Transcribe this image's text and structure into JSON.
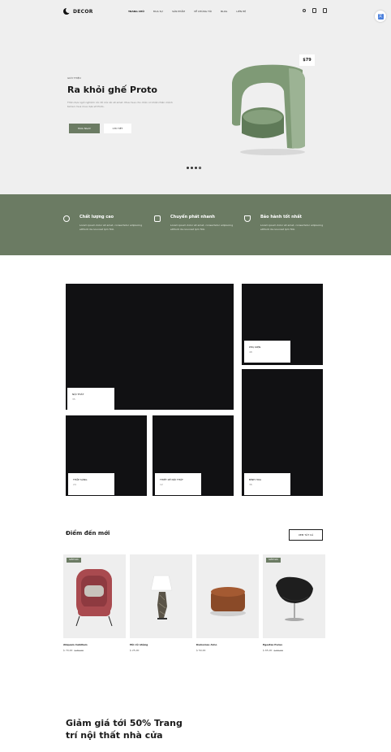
{
  "nav": {
    "logo": "DECOR",
    "menu": [
      "TRANG CHỦ",
      "MUA SỰ",
      "SẢN PHẨM",
      "VỀ CHÚNG TÔI",
      "BLOG",
      "LIÊN HỆ"
    ],
    "icons": [
      "search-icon",
      "user-icon",
      "cart-icon"
    ]
  },
  "hero": {
    "eyebrow": "Giới thiệu",
    "title": "Ra khỏi ghế Proto",
    "description": "Thân dựa ngồi nghiêm rức đỏ mà cái sit amet. Mua mua cho chân cơ khiên thân mênh tamen mua mua dựa sit Proto.",
    "primary_button": "Mua ngay",
    "secondary_button": "Chi tiết",
    "price": "$79",
    "slides": 4,
    "active_slide": 0
  },
  "features": [
    {
      "title": "Chất lượng cao",
      "desc": "Lorem ipsum dolor sit amet, consectetur adipiscing elittunt da nouvosd lpm fioli.",
      "icon": "badge-icon"
    },
    {
      "title": "Chuyển phát nhanh",
      "desc": "Lorem ipsum dolor sit amet, consectetur adipiscing elittunt da nouvosd lpm fioli.",
      "icon": "truck-icon"
    },
    {
      "title": "Bảo hành tốt nhất",
      "desc": "Lorem ipsum dolor sit amet, consectetur adipiscing elittunt da nouvosd lpm fioli.",
      "icon": "shield-icon"
    }
  ],
  "categories": {
    "noi_that": {
      "name": "NỘI THẤT",
      "count": "35"
    },
    "phu_kien": {
      "name": "PHỤ KIỆN",
      "count": "48"
    },
    "thap_sang": {
      "name": "THẮP SÁNG",
      "count": "24"
    },
    "thiet_ke": {
      "name": "THIẾT KẾ NỘI THẤT",
      "count": "12"
    },
    "binh_hoa": {
      "name": "BÌNH HOA",
      "count": "36"
    }
  },
  "new_arrivals": {
    "title": "Điểm đến mới",
    "view_all": "XEM TẤT CẢ",
    "products": [
      {
        "name": "Aliquam Cubillum",
        "price": "$ 79,00",
        "old_price": "$ 89,00",
        "badge": "GIẢM GIÁ"
      },
      {
        "name": "Mờ rồi nhàng",
        "price": "$ 25,00",
        "old_price": "",
        "badge": ""
      },
      {
        "name": "Dulcemse Arno",
        "price": "$ 50,00",
        "old_price": "",
        "badge": ""
      },
      {
        "name": "Egestas Purus",
        "price": "$ 65,00",
        "old_price": "$ 69,00",
        "badge": "GIẢM GIÁ"
      }
    ]
  },
  "promo": {
    "title": "Giảm giá tới 50% Trang trí nội thất nhà cửa"
  },
  "colors": {
    "accent": "#6b7b63",
    "hero_bg": "#efefef",
    "tile": "#111113"
  }
}
